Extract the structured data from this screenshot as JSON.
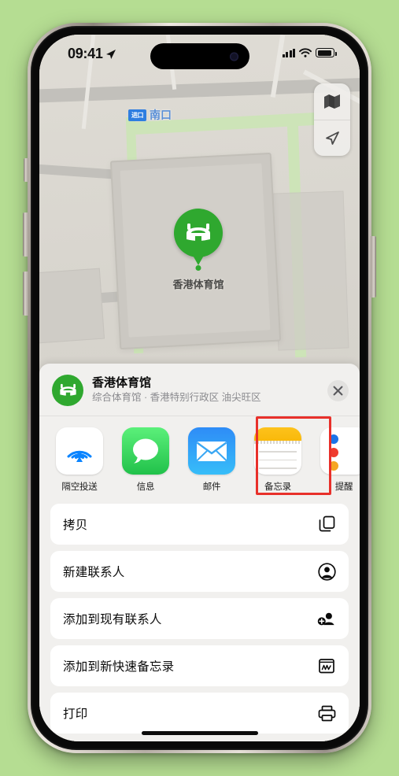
{
  "status_bar": {
    "time": "09:41",
    "location_arrow": "location-arrow-icon",
    "signal": "cellular-signal-icon",
    "wifi": "wifi-icon",
    "battery": "battery-icon"
  },
  "map": {
    "transit_badge": "进口",
    "transit_label": "南口",
    "pin_label": "香港体育馆",
    "controls": [
      {
        "name": "map-layers-button",
        "icon": "map-icon"
      },
      {
        "name": "current-location-button",
        "icon": "navigation-arrow-icon"
      }
    ]
  },
  "share_sheet": {
    "title": "香港体育馆",
    "subtitle": "综合体育馆 · 香港特别行政区 油尖旺区",
    "close_label": "✕",
    "apps": [
      {
        "name": "隔空投送",
        "id": "airdrop"
      },
      {
        "name": "信息",
        "id": "messages"
      },
      {
        "name": "邮件",
        "id": "mail"
      },
      {
        "name": "备忘录",
        "id": "notes"
      },
      {
        "name": "提醒",
        "id": "reminders"
      }
    ],
    "highlighted_app": "备忘录",
    "highlight_color": "#e8302a",
    "actions": [
      {
        "label": "拷贝",
        "icon": "copy-icon"
      },
      {
        "label": "新建联系人",
        "icon": "person-circle-icon"
      },
      {
        "label": "添加到现有联系人",
        "icon": "person-add-icon"
      },
      {
        "label": "添加到新快速备忘录",
        "icon": "quick-note-icon"
      },
      {
        "label": "打印",
        "icon": "printer-icon"
      }
    ]
  },
  "colors": {
    "background": "#b5dd92",
    "accent_green": "#2fa82f",
    "highlight_red": "#e8302a",
    "transit_blue": "#2f7ee0"
  }
}
